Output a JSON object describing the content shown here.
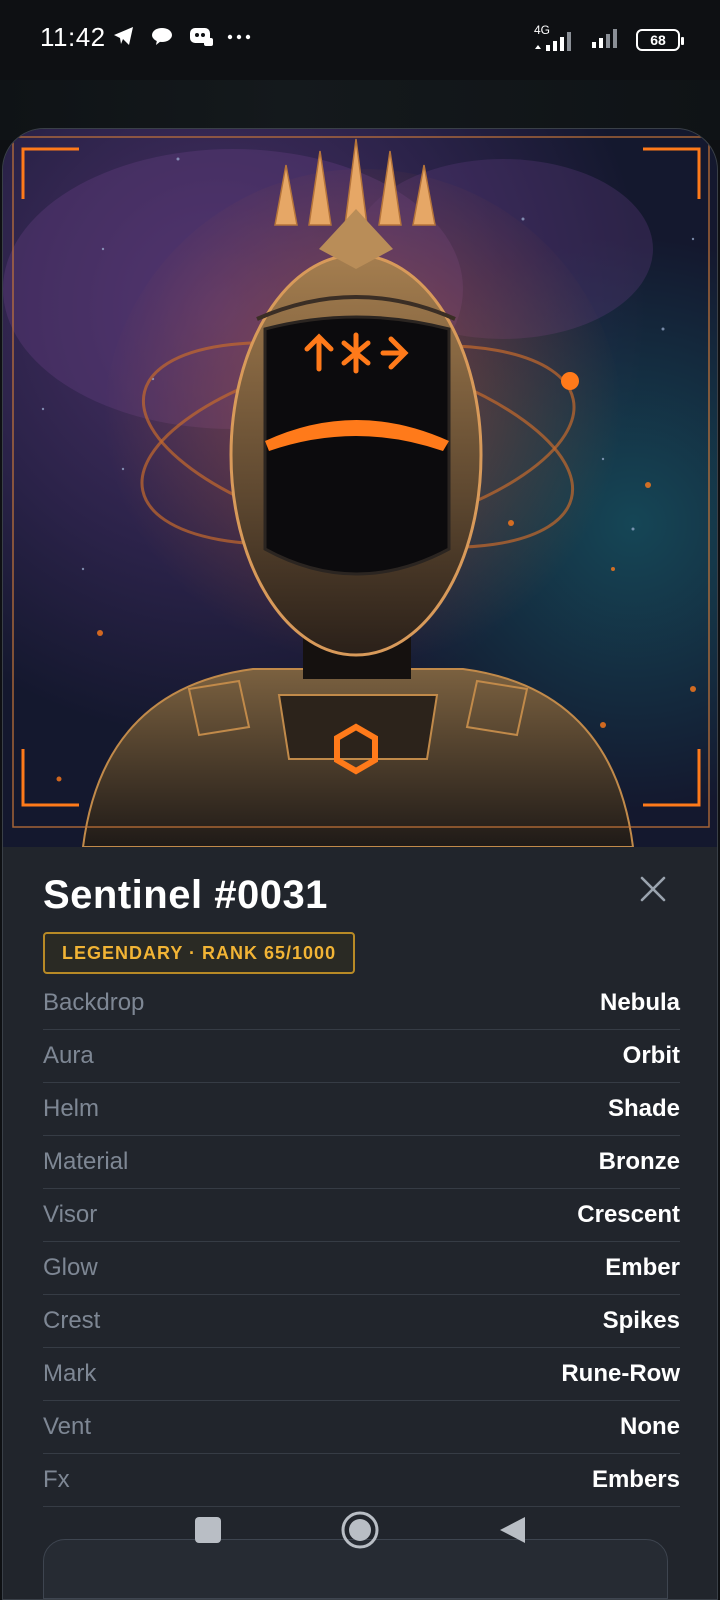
{
  "status": {
    "time": "11:42",
    "network": "4G",
    "battery": "68"
  },
  "nft": {
    "name": "Sentinel #0031",
    "rarity": "LEGENDARY · RANK 65/1000",
    "accent_color": "#ff7a1a",
    "badge_color": "#f2b435"
  },
  "traits": [
    {
      "key": "Backdrop",
      "value": "Nebula"
    },
    {
      "key": "Aura",
      "value": "Orbit"
    },
    {
      "key": "Helm",
      "value": "Shade"
    },
    {
      "key": "Material",
      "value": "Bronze"
    },
    {
      "key": "Visor",
      "value": "Crescent"
    },
    {
      "key": "Glow",
      "value": "Ember"
    },
    {
      "key": "Crest",
      "value": "Spikes"
    },
    {
      "key": "Mark",
      "value": "Rune-Row"
    },
    {
      "key": "Vent",
      "value": "None"
    },
    {
      "key": "Fx",
      "value": "Embers"
    }
  ],
  "icons": {
    "close": "close-icon",
    "nav_home": "square-icon",
    "nav_circle": "circle-icon",
    "nav_back": "triangle-back-icon"
  }
}
